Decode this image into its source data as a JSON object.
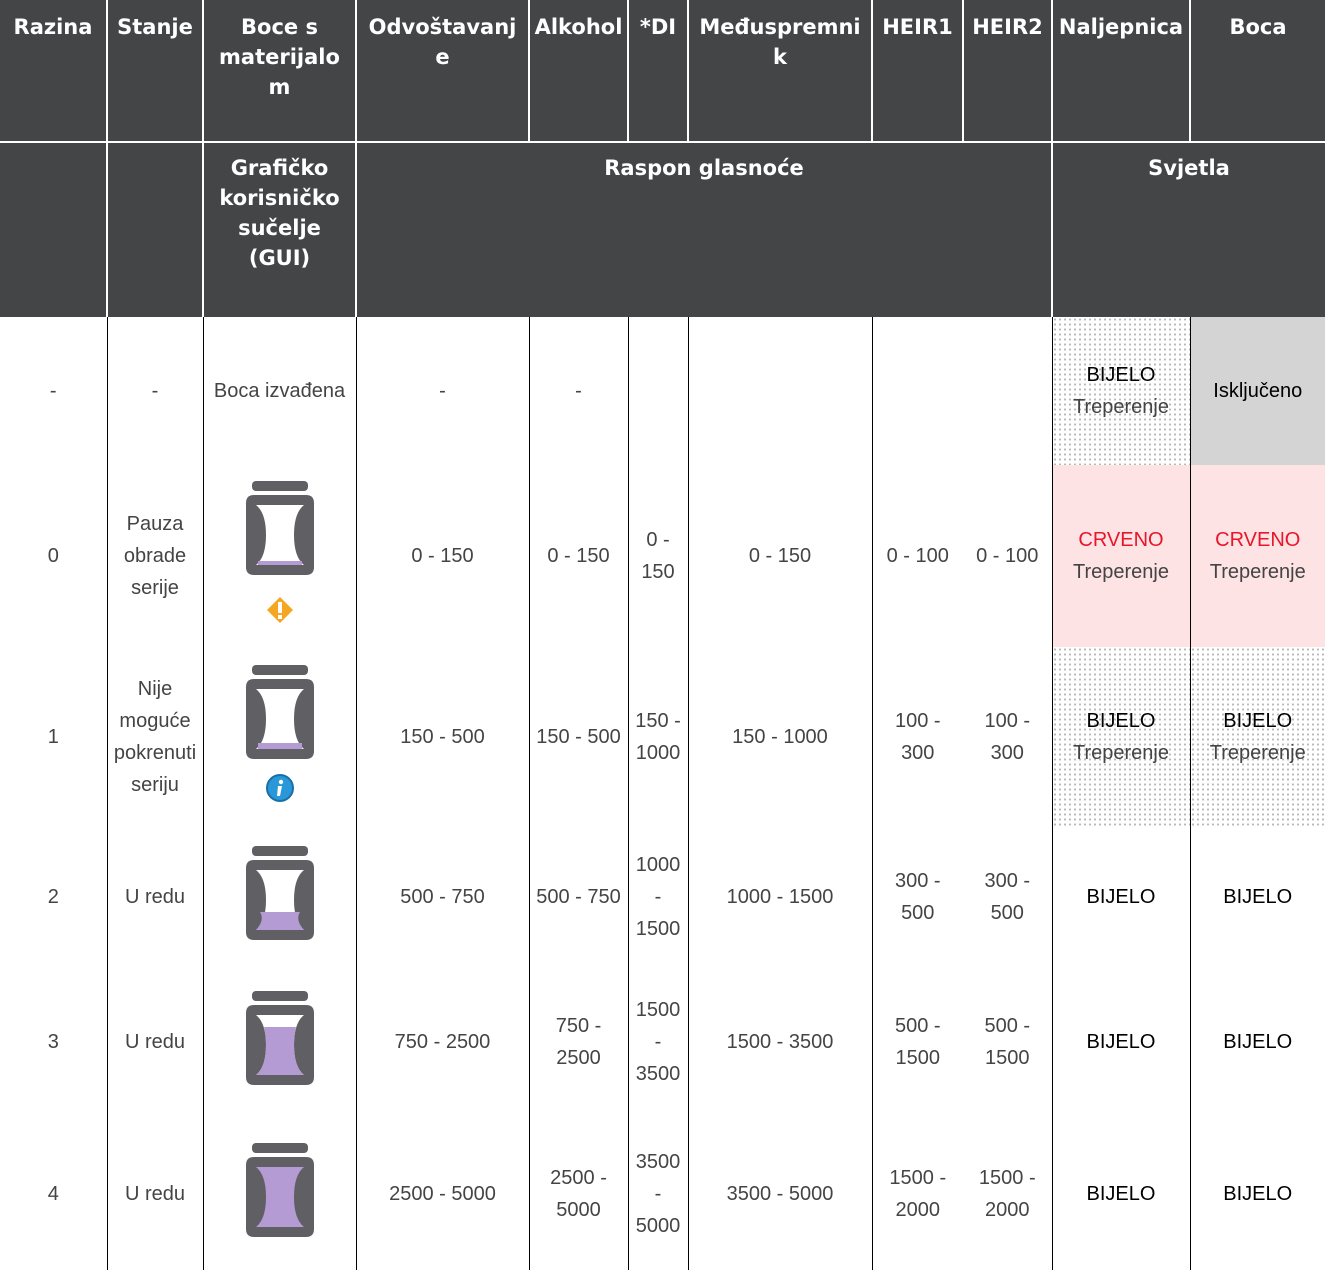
{
  "header": {
    "row1": [
      "Razina",
      "Stanje",
      "Boce s materijalo m",
      "Odvoštavanj e",
      "Alkohol",
      "*DI",
      "Međuspremni k",
      "HEIR1",
      "HEIR2",
      "Naljepnica",
      "Boca"
    ],
    "row1_lines": {
      "boce": [
        "Boce s",
        "materijalo",
        "m"
      ],
      "odvostavanje": [
        "Odvoštavanj",
        "e"
      ],
      "meduspremnik": [
        "Međuspremni",
        "k"
      ]
    },
    "row2": {
      "gui_lines": [
        "Grafičko",
        "korisničko",
        "sučelje",
        "(GUI)"
      ],
      "volume_range": "Raspon glasnoće",
      "lights": "Svjetla"
    }
  },
  "rows": [
    {
      "level": "-",
      "state": "-",
      "gui_text": "Boca izvađena",
      "odvostavanje": "-",
      "alkohol": "-",
      "di": "",
      "meduspremnik": "",
      "heir1": "",
      "heir2": "",
      "label_light": [
        "BIJELO",
        "Treperenje"
      ],
      "bottle_light": [
        "Isključeno"
      ],
      "gui_icon": "none"
    },
    {
      "level": "0",
      "state_lines": [
        "Pauza",
        "obrade",
        "serije"
      ],
      "gui_icon": "bottle-almost-empty-warning",
      "odvostavanje": "0 - 150",
      "alkohol": "0 - 150",
      "di_lines": [
        "0 -",
        "150"
      ],
      "meduspremnik": "0 - 150",
      "heir1": "0 - 100",
      "heir2": "0 - 100",
      "label_light": [
        "CRVENO",
        "Treperenje"
      ],
      "bottle_light": [
        "CRVENO",
        "Treperenje"
      ]
    },
    {
      "level": "1",
      "state_lines": [
        "Nije",
        "moguće",
        "pokrenuti",
        "seriju"
      ],
      "gui_icon": "bottle-low-info",
      "odvostavanje": "150 - 500",
      "alkohol": "150 - 500",
      "di_lines": [
        "150 -",
        "1000"
      ],
      "meduspremnik": "150 - 1000",
      "heir1_lines": [
        "100 -",
        "300"
      ],
      "heir2_lines": [
        "100 -",
        "300"
      ],
      "label_light": [
        "BIJELO",
        "Treperenje"
      ],
      "bottle_light": [
        "BIJELO",
        "Treperenje"
      ]
    },
    {
      "level": "2",
      "state": "U redu",
      "gui_icon": "bottle-quarter",
      "odvostavanje": "500 - 750",
      "alkohol": "500 - 750",
      "di_lines": [
        "1000",
        "-",
        "1500"
      ],
      "meduspremnik": "1000 - 1500",
      "heir1_lines": [
        "300 -",
        "500"
      ],
      "heir2_lines": [
        "300 -",
        "500"
      ],
      "label_light": [
        "BIJELO"
      ],
      "bottle_light": [
        "BIJELO"
      ]
    },
    {
      "level": "3",
      "state": "U redu",
      "gui_icon": "bottle-three-quarter",
      "odvostavanje": "750 - 2500",
      "alkohol_lines": [
        "750 -",
        "2500"
      ],
      "di_lines": [
        "1500",
        "-",
        "3500"
      ],
      "meduspremnik": "1500 - 3500",
      "heir1_lines": [
        "500 -",
        "1500"
      ],
      "heir2_lines": [
        "500 -",
        "1500"
      ],
      "label_light": [
        "BIJELO"
      ],
      "bottle_light": [
        "BIJELO"
      ]
    },
    {
      "level": "4",
      "state": "U redu",
      "gui_icon": "bottle-full",
      "odvostavanje": "2500 - 5000",
      "alkohol_lines": [
        "2500 -",
        "5000"
      ],
      "di_lines": [
        "3500",
        "-",
        "5000"
      ],
      "meduspremnik": "3500 - 5000",
      "heir1_lines": [
        "1500 -",
        "2000"
      ],
      "heir2_lines": [
        "1500 -",
        "2000"
      ],
      "label_light": [
        "BIJELO"
      ],
      "bottle_light": [
        "BIJELO"
      ]
    }
  ],
  "colors": {
    "header_bg": "#444547",
    "bottle_frame": "#5f5f64",
    "liquid": "#b49bd4",
    "warning": "#f5a623",
    "info": "#2a97d8",
    "red_text": "#e8152b",
    "pink_bg": "#fde3e3",
    "grey_bg": "#d4d4d4"
  }
}
